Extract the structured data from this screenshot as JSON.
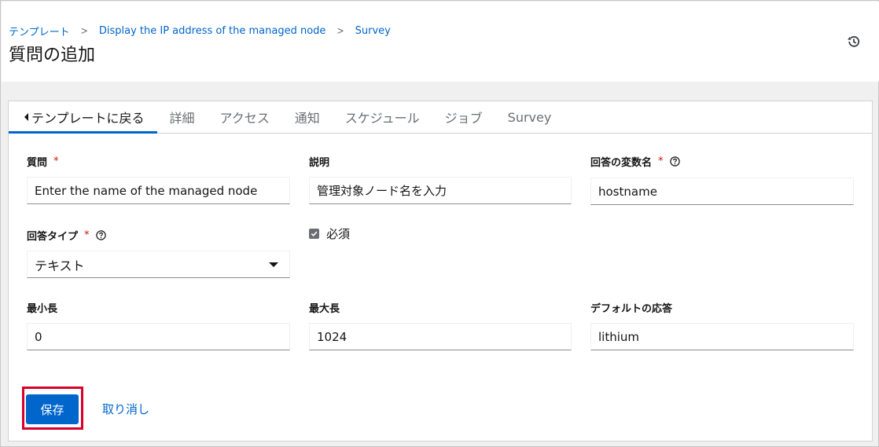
{
  "breadcrumb": {
    "items": [
      "テンプレート",
      "Display the IP address of the managed node",
      "Survey"
    ],
    "separator": ">"
  },
  "page": {
    "title": "質問の追加",
    "history_icon": "history-icon"
  },
  "tabs": [
    {
      "label": "テンプレートに戻る",
      "active": true,
      "icon": "caret-left-icon"
    },
    {
      "label": "詳細"
    },
    {
      "label": "アクセス"
    },
    {
      "label": "通知"
    },
    {
      "label": "スケジュール"
    },
    {
      "label": "ジョブ"
    },
    {
      "label": "Survey"
    }
  ],
  "form": {
    "question": {
      "label": "質問",
      "required": "*",
      "value": "Enter the name of the managed node"
    },
    "description": {
      "label": "説明",
      "value": "管理対象ノード名を入力"
    },
    "variable": {
      "label": "回答の変数名",
      "required": "*",
      "value": "hostname"
    },
    "answer_type": {
      "label": "回答タイプ",
      "required": "*",
      "value": "テキスト"
    },
    "required_checkbox": {
      "label": "必須",
      "checked": true
    },
    "min_length": {
      "label": "最小長",
      "value": "0"
    },
    "max_length": {
      "label": "最大長",
      "value": "1024"
    },
    "default_answer": {
      "label": "デフォルトの応答",
      "value": "lithium"
    }
  },
  "actions": {
    "save_label": "保存",
    "cancel_label": "取り消し"
  },
  "colors": {
    "primary": "#0066cc",
    "required": "#c9190b",
    "highlight": "#d6002a"
  }
}
